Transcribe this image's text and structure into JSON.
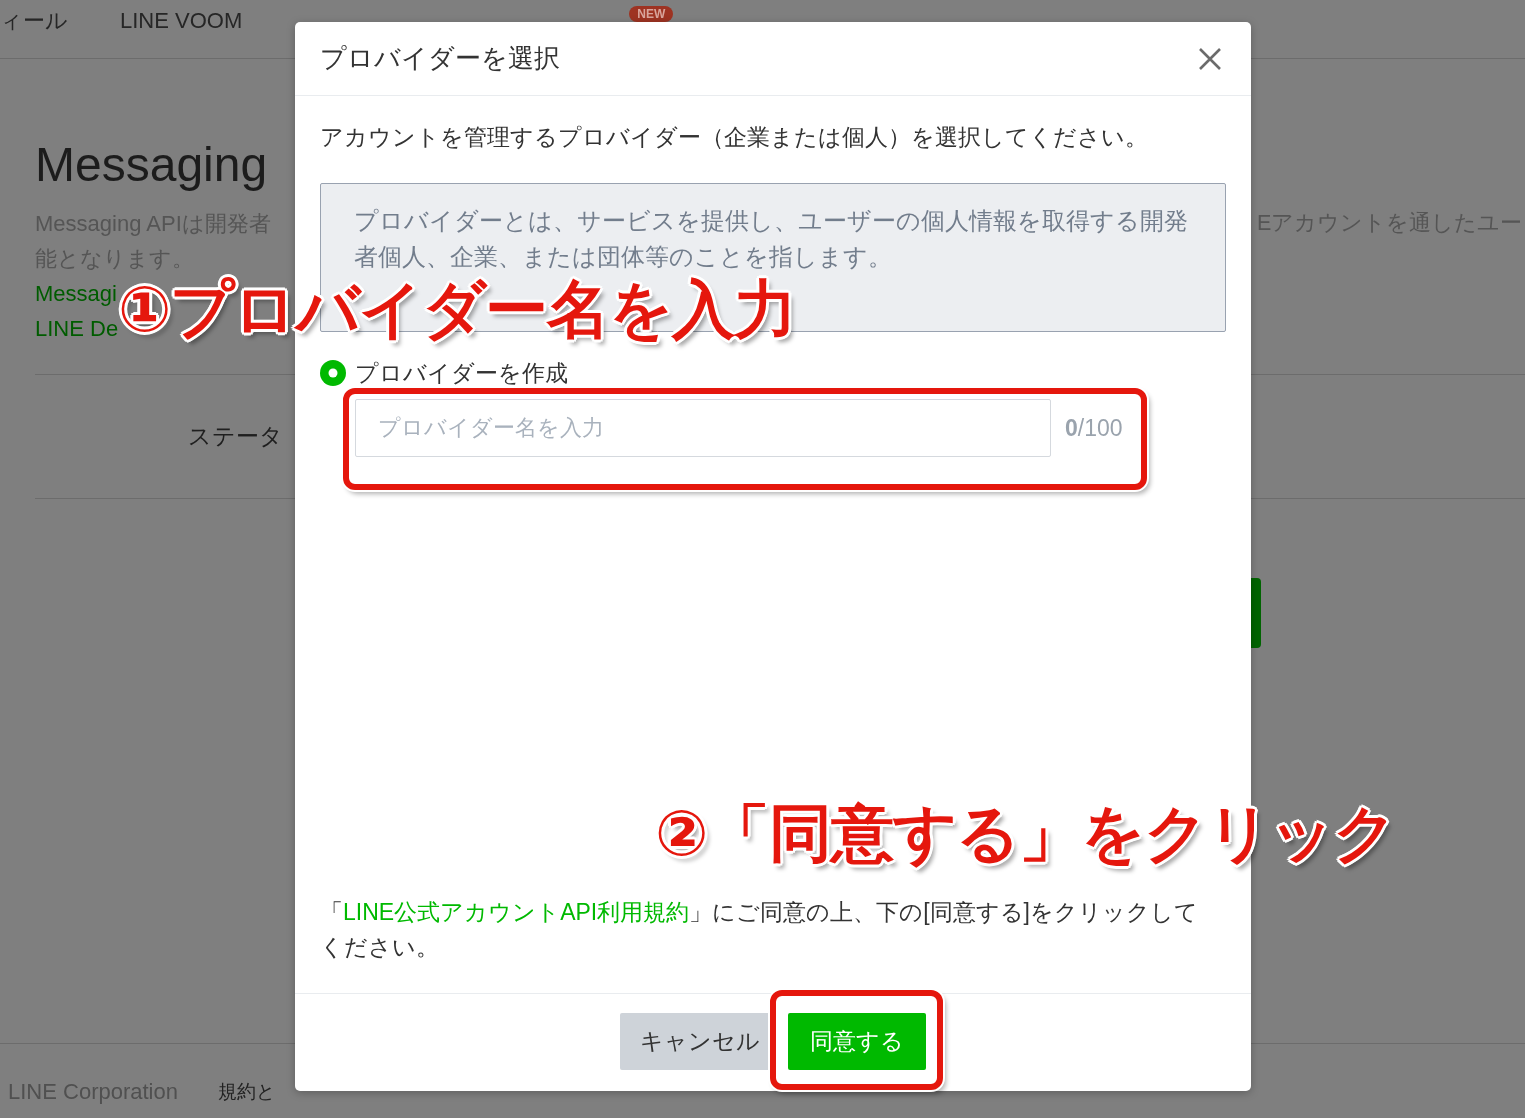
{
  "nav": {
    "items": [
      {
        "label": "ィール"
      },
      {
        "label": "LINE VOOM"
      },
      {
        "badge": "NEW"
      }
    ]
  },
  "page": {
    "heading": "Messaging",
    "description_left": [
      "Messaging APIは開発者",
      "能となります。"
    ],
    "description_right": "Eアカウントを通したユー",
    "links": [
      "Messagi",
      "LINE De"
    ],
    "status_label": "ステータ"
  },
  "footer": {
    "company": "LINE Corporation",
    "links": [
      "規約と"
    ]
  },
  "dialog": {
    "title": "プロバイダーを選択",
    "intro": "アカウントを管理するプロバイダー（企業または個人）を選択してください。",
    "info": "プロバイダーとは、サービスを提供し、ユーザーの個人情報を取得する開発者個人、企業、または団体等のことを指します。",
    "option": {
      "label": "プロバイダーを作成",
      "selected": true
    },
    "provider_name": {
      "placeholder": "プロバイダー名を入力",
      "counter": "**0**/100"
    },
    "terms": {
      "before": "「",
      "link": "LINE公式アカウントAPI利用規約",
      "after": "」にご同意の上、下の[同意する]をクリックしてください。"
    },
    "buttons": [
      {
        "label": "キャンセル",
        "kind": "secondary"
      },
      {
        "label": "同意する",
        "kind": "primary"
      }
    ]
  },
  "annotations": [
    {
      "text": "①プロバイダー名を入力",
      "kind": "step"
    },
    {
      "text": "②「同意する」をクリック",
      "kind": "step"
    }
  ]
}
